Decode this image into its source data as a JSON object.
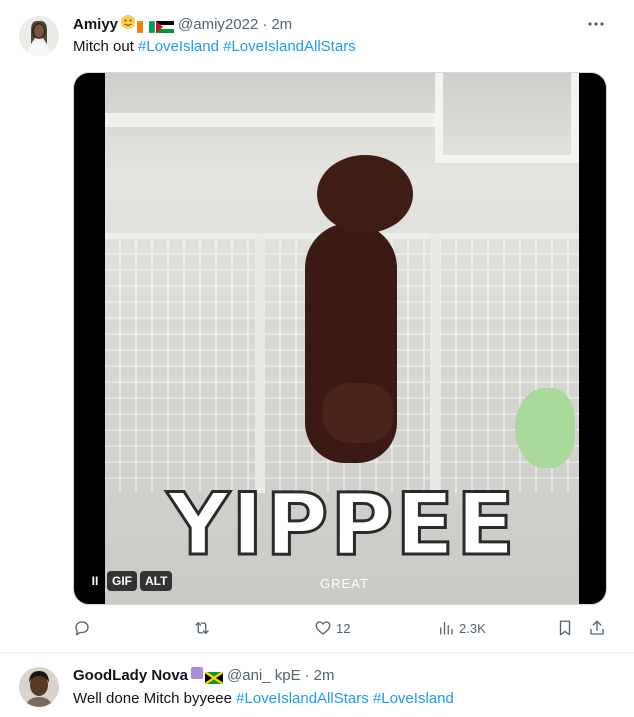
{
  "tweets": [
    {
      "display_name": "Amiyy",
      "handle": "@amiy2022",
      "separator": "·",
      "time": "2m",
      "text_plain": "Mitch out",
      "hashtags": [
        "#LoveIsland",
        "#LoveIslandAllStars"
      ],
      "avatar_icon": "avatar-photo",
      "name_emojis": [
        "smiling-face-icon",
        "ivory-coast-flag-icon",
        "palestine-flag-icon"
      ],
      "media": {
        "gif_caption": "YIPPEE",
        "gif_subcaption": "GREAT",
        "badges": {
          "pause_label": "II",
          "gif_label": "GIF",
          "alt_label": "ALT"
        }
      },
      "actions": {
        "reply_count": "",
        "retweet_count": "",
        "like_count": "12",
        "views_count": "2.3K"
      }
    },
    {
      "display_name": "GoodLady Nova",
      "handle": "@ani_ kpE",
      "separator": "·",
      "time": "2m",
      "text_plain": "Well done Mitch byyeee",
      "hashtags": [
        "#LoveIslandAllStars",
        "#LoveIsland"
      ]
    }
  ],
  "colors": {
    "accent": "#1d9bf0",
    "muted": "#536471",
    "text": "#0f1419"
  }
}
